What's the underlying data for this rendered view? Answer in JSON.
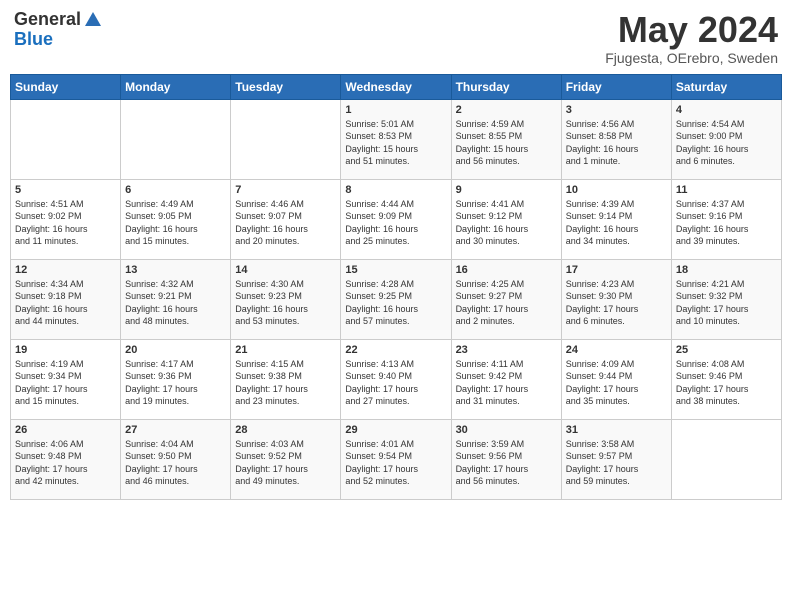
{
  "header": {
    "logo_general": "General",
    "logo_blue": "Blue",
    "month_year": "May 2024",
    "location": "Fjugesta, OErebro, Sweden"
  },
  "weekdays": [
    "Sunday",
    "Monday",
    "Tuesday",
    "Wednesday",
    "Thursday",
    "Friday",
    "Saturday"
  ],
  "weeks": [
    [
      {
        "day": "",
        "content": ""
      },
      {
        "day": "",
        "content": ""
      },
      {
        "day": "",
        "content": ""
      },
      {
        "day": "1",
        "content": "Sunrise: 5:01 AM\nSunset: 8:53 PM\nDaylight: 15 hours\nand 51 minutes."
      },
      {
        "day": "2",
        "content": "Sunrise: 4:59 AM\nSunset: 8:55 PM\nDaylight: 15 hours\nand 56 minutes."
      },
      {
        "day": "3",
        "content": "Sunrise: 4:56 AM\nSunset: 8:58 PM\nDaylight: 16 hours\nand 1 minute."
      },
      {
        "day": "4",
        "content": "Sunrise: 4:54 AM\nSunset: 9:00 PM\nDaylight: 16 hours\nand 6 minutes."
      }
    ],
    [
      {
        "day": "5",
        "content": "Sunrise: 4:51 AM\nSunset: 9:02 PM\nDaylight: 16 hours\nand 11 minutes."
      },
      {
        "day": "6",
        "content": "Sunrise: 4:49 AM\nSunset: 9:05 PM\nDaylight: 16 hours\nand 15 minutes."
      },
      {
        "day": "7",
        "content": "Sunrise: 4:46 AM\nSunset: 9:07 PM\nDaylight: 16 hours\nand 20 minutes."
      },
      {
        "day": "8",
        "content": "Sunrise: 4:44 AM\nSunset: 9:09 PM\nDaylight: 16 hours\nand 25 minutes."
      },
      {
        "day": "9",
        "content": "Sunrise: 4:41 AM\nSunset: 9:12 PM\nDaylight: 16 hours\nand 30 minutes."
      },
      {
        "day": "10",
        "content": "Sunrise: 4:39 AM\nSunset: 9:14 PM\nDaylight: 16 hours\nand 34 minutes."
      },
      {
        "day": "11",
        "content": "Sunrise: 4:37 AM\nSunset: 9:16 PM\nDaylight: 16 hours\nand 39 minutes."
      }
    ],
    [
      {
        "day": "12",
        "content": "Sunrise: 4:34 AM\nSunset: 9:18 PM\nDaylight: 16 hours\nand 44 minutes."
      },
      {
        "day": "13",
        "content": "Sunrise: 4:32 AM\nSunset: 9:21 PM\nDaylight: 16 hours\nand 48 minutes."
      },
      {
        "day": "14",
        "content": "Sunrise: 4:30 AM\nSunset: 9:23 PM\nDaylight: 16 hours\nand 53 minutes."
      },
      {
        "day": "15",
        "content": "Sunrise: 4:28 AM\nSunset: 9:25 PM\nDaylight: 16 hours\nand 57 minutes."
      },
      {
        "day": "16",
        "content": "Sunrise: 4:25 AM\nSunset: 9:27 PM\nDaylight: 17 hours\nand 2 minutes."
      },
      {
        "day": "17",
        "content": "Sunrise: 4:23 AM\nSunset: 9:30 PM\nDaylight: 17 hours\nand 6 minutes."
      },
      {
        "day": "18",
        "content": "Sunrise: 4:21 AM\nSunset: 9:32 PM\nDaylight: 17 hours\nand 10 minutes."
      }
    ],
    [
      {
        "day": "19",
        "content": "Sunrise: 4:19 AM\nSunset: 9:34 PM\nDaylight: 17 hours\nand 15 minutes."
      },
      {
        "day": "20",
        "content": "Sunrise: 4:17 AM\nSunset: 9:36 PM\nDaylight: 17 hours\nand 19 minutes."
      },
      {
        "day": "21",
        "content": "Sunrise: 4:15 AM\nSunset: 9:38 PM\nDaylight: 17 hours\nand 23 minutes."
      },
      {
        "day": "22",
        "content": "Sunrise: 4:13 AM\nSunset: 9:40 PM\nDaylight: 17 hours\nand 27 minutes."
      },
      {
        "day": "23",
        "content": "Sunrise: 4:11 AM\nSunset: 9:42 PM\nDaylight: 17 hours\nand 31 minutes."
      },
      {
        "day": "24",
        "content": "Sunrise: 4:09 AM\nSunset: 9:44 PM\nDaylight: 17 hours\nand 35 minutes."
      },
      {
        "day": "25",
        "content": "Sunrise: 4:08 AM\nSunset: 9:46 PM\nDaylight: 17 hours\nand 38 minutes."
      }
    ],
    [
      {
        "day": "26",
        "content": "Sunrise: 4:06 AM\nSunset: 9:48 PM\nDaylight: 17 hours\nand 42 minutes."
      },
      {
        "day": "27",
        "content": "Sunrise: 4:04 AM\nSunset: 9:50 PM\nDaylight: 17 hours\nand 46 minutes."
      },
      {
        "day": "28",
        "content": "Sunrise: 4:03 AM\nSunset: 9:52 PM\nDaylight: 17 hours\nand 49 minutes."
      },
      {
        "day": "29",
        "content": "Sunrise: 4:01 AM\nSunset: 9:54 PM\nDaylight: 17 hours\nand 52 minutes."
      },
      {
        "day": "30",
        "content": "Sunrise: 3:59 AM\nSunset: 9:56 PM\nDaylight: 17 hours\nand 56 minutes."
      },
      {
        "day": "31",
        "content": "Sunrise: 3:58 AM\nSunset: 9:57 PM\nDaylight: 17 hours\nand 59 minutes."
      },
      {
        "day": "",
        "content": ""
      }
    ]
  ]
}
